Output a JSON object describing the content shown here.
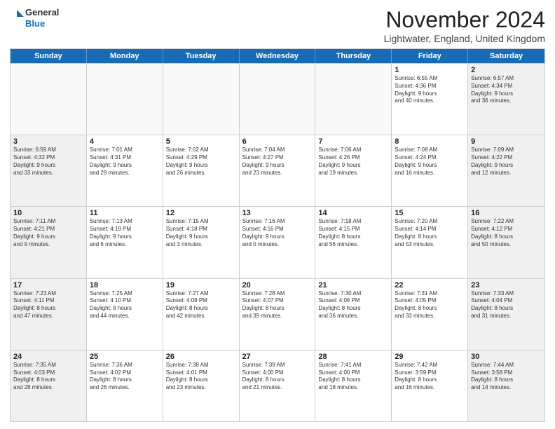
{
  "logo": {
    "general": "General",
    "blue": "Blue"
  },
  "title": "November 2024",
  "location": "Lightwater, England, United Kingdom",
  "header_days": [
    "Sunday",
    "Monday",
    "Tuesday",
    "Wednesday",
    "Thursday",
    "Friday",
    "Saturday"
  ],
  "weeks": [
    [
      {
        "day": "",
        "text": ""
      },
      {
        "day": "",
        "text": ""
      },
      {
        "day": "",
        "text": ""
      },
      {
        "day": "",
        "text": ""
      },
      {
        "day": "",
        "text": ""
      },
      {
        "day": "1",
        "text": "Sunrise: 6:55 AM\nSunset: 4:36 PM\nDaylight: 9 hours\nand 40 minutes."
      },
      {
        "day": "2",
        "text": "Sunrise: 6:57 AM\nSunset: 4:34 PM\nDaylight: 9 hours\nand 36 minutes."
      }
    ],
    [
      {
        "day": "3",
        "text": "Sunrise: 6:59 AM\nSunset: 4:32 PM\nDaylight: 9 hours\nand 33 minutes."
      },
      {
        "day": "4",
        "text": "Sunrise: 7:01 AM\nSunset: 4:31 PM\nDaylight: 9 hours\nand 29 minutes."
      },
      {
        "day": "5",
        "text": "Sunrise: 7:02 AM\nSunset: 4:29 PM\nDaylight: 9 hours\nand 26 minutes."
      },
      {
        "day": "6",
        "text": "Sunrise: 7:04 AM\nSunset: 4:27 PM\nDaylight: 9 hours\nand 23 minutes."
      },
      {
        "day": "7",
        "text": "Sunrise: 7:06 AM\nSunset: 4:26 PM\nDaylight: 9 hours\nand 19 minutes."
      },
      {
        "day": "8",
        "text": "Sunrise: 7:08 AM\nSunset: 4:24 PM\nDaylight: 9 hours\nand 16 minutes."
      },
      {
        "day": "9",
        "text": "Sunrise: 7:09 AM\nSunset: 4:22 PM\nDaylight: 9 hours\nand 12 minutes."
      }
    ],
    [
      {
        "day": "10",
        "text": "Sunrise: 7:11 AM\nSunset: 4:21 PM\nDaylight: 9 hours\nand 9 minutes."
      },
      {
        "day": "11",
        "text": "Sunrise: 7:13 AM\nSunset: 4:19 PM\nDaylight: 9 hours\nand 6 minutes."
      },
      {
        "day": "12",
        "text": "Sunrise: 7:15 AM\nSunset: 4:18 PM\nDaylight: 9 hours\nand 3 minutes."
      },
      {
        "day": "13",
        "text": "Sunrise: 7:16 AM\nSunset: 4:16 PM\nDaylight: 9 hours\nand 0 minutes."
      },
      {
        "day": "14",
        "text": "Sunrise: 7:18 AM\nSunset: 4:15 PM\nDaylight: 8 hours\nand 56 minutes."
      },
      {
        "day": "15",
        "text": "Sunrise: 7:20 AM\nSunset: 4:14 PM\nDaylight: 8 hours\nand 53 minutes."
      },
      {
        "day": "16",
        "text": "Sunrise: 7:22 AM\nSunset: 4:12 PM\nDaylight: 8 hours\nand 50 minutes."
      }
    ],
    [
      {
        "day": "17",
        "text": "Sunrise: 7:23 AM\nSunset: 4:11 PM\nDaylight: 8 hours\nand 47 minutes."
      },
      {
        "day": "18",
        "text": "Sunrise: 7:25 AM\nSunset: 4:10 PM\nDaylight: 8 hours\nand 44 minutes."
      },
      {
        "day": "19",
        "text": "Sunrise: 7:27 AM\nSunset: 4:09 PM\nDaylight: 8 hours\nand 42 minutes."
      },
      {
        "day": "20",
        "text": "Sunrise: 7:28 AM\nSunset: 4:07 PM\nDaylight: 8 hours\nand 39 minutes."
      },
      {
        "day": "21",
        "text": "Sunrise: 7:30 AM\nSunset: 4:06 PM\nDaylight: 8 hours\nand 36 minutes."
      },
      {
        "day": "22",
        "text": "Sunrise: 7:31 AM\nSunset: 4:05 PM\nDaylight: 8 hours\nand 33 minutes."
      },
      {
        "day": "23",
        "text": "Sunrise: 7:33 AM\nSunset: 4:04 PM\nDaylight: 8 hours\nand 31 minutes."
      }
    ],
    [
      {
        "day": "24",
        "text": "Sunrise: 7:35 AM\nSunset: 4:03 PM\nDaylight: 8 hours\nand 28 minutes."
      },
      {
        "day": "25",
        "text": "Sunrise: 7:36 AM\nSunset: 4:02 PM\nDaylight: 8 hours\nand 26 minutes."
      },
      {
        "day": "26",
        "text": "Sunrise: 7:38 AM\nSunset: 4:01 PM\nDaylight: 8 hours\nand 23 minutes."
      },
      {
        "day": "27",
        "text": "Sunrise: 7:39 AM\nSunset: 4:00 PM\nDaylight: 8 hours\nand 21 minutes."
      },
      {
        "day": "28",
        "text": "Sunrise: 7:41 AM\nSunset: 4:00 PM\nDaylight: 8 hours\nand 18 minutes."
      },
      {
        "day": "29",
        "text": "Sunrise: 7:42 AM\nSunset: 3:59 PM\nDaylight: 8 hours\nand 16 minutes."
      },
      {
        "day": "30",
        "text": "Sunrise: 7:44 AM\nSunset: 3:58 PM\nDaylight: 8 hours\nand 14 minutes."
      }
    ]
  ]
}
